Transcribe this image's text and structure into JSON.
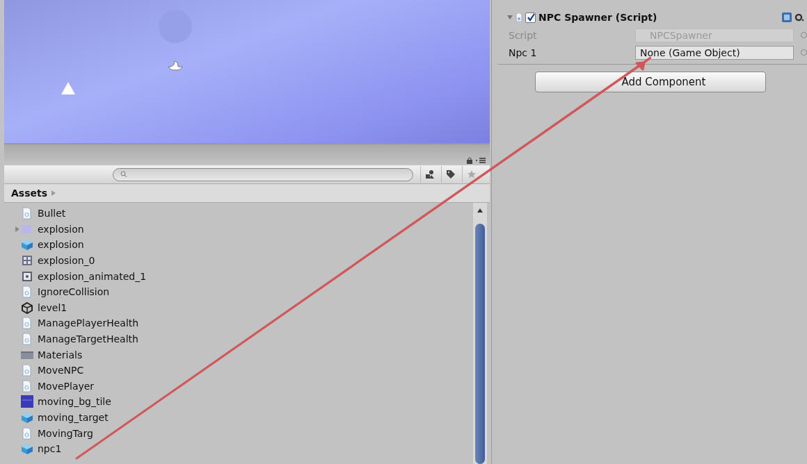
{
  "project": {
    "breadcrumb": "Assets",
    "items": [
      {
        "name": "Bullet",
        "kind": "script",
        "foldout": false
      },
      {
        "name": "explosion",
        "kind": "animation",
        "foldout": true
      },
      {
        "name": "explosion",
        "kind": "prefab",
        "foldout": false
      },
      {
        "name": "explosion_0",
        "kind": "sprite",
        "foldout": false
      },
      {
        "name": "explosion_animated_1",
        "kind": "controller",
        "foldout": false
      },
      {
        "name": "IgnoreCollision",
        "kind": "script",
        "foldout": false
      },
      {
        "name": "level1",
        "kind": "scene",
        "foldout": false
      },
      {
        "name": "ManagePlayerHealth",
        "kind": "script",
        "foldout": false
      },
      {
        "name": "ManageTargetHealth",
        "kind": "script",
        "foldout": false
      },
      {
        "name": "Materials",
        "kind": "folder",
        "foldout": false
      },
      {
        "name": "MoveNPC",
        "kind": "script",
        "foldout": false
      },
      {
        "name": "MovePlayer",
        "kind": "script",
        "foldout": false
      },
      {
        "name": "moving_bg_tile",
        "kind": "texture",
        "foldout": false
      },
      {
        "name": "moving_target",
        "kind": "prefab",
        "foldout": false
      },
      {
        "name": "MovingTarg",
        "kind": "script",
        "foldout": false
      },
      {
        "name": "npc1",
        "kind": "prefab",
        "foldout": false
      }
    ]
  },
  "inspector": {
    "component": {
      "title": "NPC Spawner (Script)",
      "enabled": true,
      "expanded": true,
      "fields": [
        {
          "label": "Script",
          "value": "NPCSpawner",
          "disabled": true
        },
        {
          "label": "Npc 1",
          "value": "None (Game Object)",
          "disabled": false
        }
      ]
    },
    "add_button": "Add Component"
  }
}
